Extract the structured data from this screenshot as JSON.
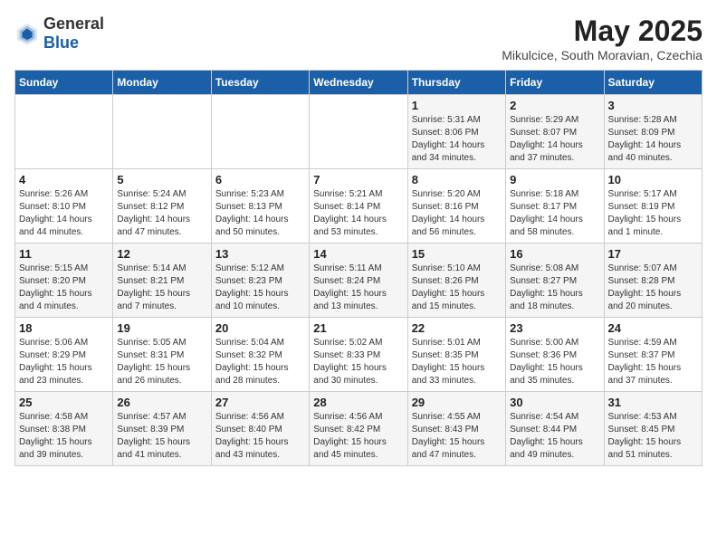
{
  "header": {
    "logo_general": "General",
    "logo_blue": "Blue",
    "month_title": "May 2025",
    "subtitle": "Mikulcice, South Moravian, Czechia"
  },
  "weekdays": [
    "Sunday",
    "Monday",
    "Tuesday",
    "Wednesday",
    "Thursday",
    "Friday",
    "Saturday"
  ],
  "weeks": [
    [
      {
        "day": "",
        "info": ""
      },
      {
        "day": "",
        "info": ""
      },
      {
        "day": "",
        "info": ""
      },
      {
        "day": "",
        "info": ""
      },
      {
        "day": "1",
        "info": "Sunrise: 5:31 AM\nSunset: 8:06 PM\nDaylight: 14 hours\nand 34 minutes."
      },
      {
        "day": "2",
        "info": "Sunrise: 5:29 AM\nSunset: 8:07 PM\nDaylight: 14 hours\nand 37 minutes."
      },
      {
        "day": "3",
        "info": "Sunrise: 5:28 AM\nSunset: 8:09 PM\nDaylight: 14 hours\nand 40 minutes."
      }
    ],
    [
      {
        "day": "4",
        "info": "Sunrise: 5:26 AM\nSunset: 8:10 PM\nDaylight: 14 hours\nand 44 minutes."
      },
      {
        "day": "5",
        "info": "Sunrise: 5:24 AM\nSunset: 8:12 PM\nDaylight: 14 hours\nand 47 minutes."
      },
      {
        "day": "6",
        "info": "Sunrise: 5:23 AM\nSunset: 8:13 PM\nDaylight: 14 hours\nand 50 minutes."
      },
      {
        "day": "7",
        "info": "Sunrise: 5:21 AM\nSunset: 8:14 PM\nDaylight: 14 hours\nand 53 minutes."
      },
      {
        "day": "8",
        "info": "Sunrise: 5:20 AM\nSunset: 8:16 PM\nDaylight: 14 hours\nand 56 minutes."
      },
      {
        "day": "9",
        "info": "Sunrise: 5:18 AM\nSunset: 8:17 PM\nDaylight: 14 hours\nand 58 minutes."
      },
      {
        "day": "10",
        "info": "Sunrise: 5:17 AM\nSunset: 8:19 PM\nDaylight: 15 hours\nand 1 minute."
      }
    ],
    [
      {
        "day": "11",
        "info": "Sunrise: 5:15 AM\nSunset: 8:20 PM\nDaylight: 15 hours\nand 4 minutes."
      },
      {
        "day": "12",
        "info": "Sunrise: 5:14 AM\nSunset: 8:21 PM\nDaylight: 15 hours\nand 7 minutes."
      },
      {
        "day": "13",
        "info": "Sunrise: 5:12 AM\nSunset: 8:23 PM\nDaylight: 15 hours\nand 10 minutes."
      },
      {
        "day": "14",
        "info": "Sunrise: 5:11 AM\nSunset: 8:24 PM\nDaylight: 15 hours\nand 13 minutes."
      },
      {
        "day": "15",
        "info": "Sunrise: 5:10 AM\nSunset: 8:26 PM\nDaylight: 15 hours\nand 15 minutes."
      },
      {
        "day": "16",
        "info": "Sunrise: 5:08 AM\nSunset: 8:27 PM\nDaylight: 15 hours\nand 18 minutes."
      },
      {
        "day": "17",
        "info": "Sunrise: 5:07 AM\nSunset: 8:28 PM\nDaylight: 15 hours\nand 20 minutes."
      }
    ],
    [
      {
        "day": "18",
        "info": "Sunrise: 5:06 AM\nSunset: 8:29 PM\nDaylight: 15 hours\nand 23 minutes."
      },
      {
        "day": "19",
        "info": "Sunrise: 5:05 AM\nSunset: 8:31 PM\nDaylight: 15 hours\nand 26 minutes."
      },
      {
        "day": "20",
        "info": "Sunrise: 5:04 AM\nSunset: 8:32 PM\nDaylight: 15 hours\nand 28 minutes."
      },
      {
        "day": "21",
        "info": "Sunrise: 5:02 AM\nSunset: 8:33 PM\nDaylight: 15 hours\nand 30 minutes."
      },
      {
        "day": "22",
        "info": "Sunrise: 5:01 AM\nSunset: 8:35 PM\nDaylight: 15 hours\nand 33 minutes."
      },
      {
        "day": "23",
        "info": "Sunrise: 5:00 AM\nSunset: 8:36 PM\nDaylight: 15 hours\nand 35 minutes."
      },
      {
        "day": "24",
        "info": "Sunrise: 4:59 AM\nSunset: 8:37 PM\nDaylight: 15 hours\nand 37 minutes."
      }
    ],
    [
      {
        "day": "25",
        "info": "Sunrise: 4:58 AM\nSunset: 8:38 PM\nDaylight: 15 hours\nand 39 minutes."
      },
      {
        "day": "26",
        "info": "Sunrise: 4:57 AM\nSunset: 8:39 PM\nDaylight: 15 hours\nand 41 minutes."
      },
      {
        "day": "27",
        "info": "Sunrise: 4:56 AM\nSunset: 8:40 PM\nDaylight: 15 hours\nand 43 minutes."
      },
      {
        "day": "28",
        "info": "Sunrise: 4:56 AM\nSunset: 8:42 PM\nDaylight: 15 hours\nand 45 minutes."
      },
      {
        "day": "29",
        "info": "Sunrise: 4:55 AM\nSunset: 8:43 PM\nDaylight: 15 hours\nand 47 minutes."
      },
      {
        "day": "30",
        "info": "Sunrise: 4:54 AM\nSunset: 8:44 PM\nDaylight: 15 hours\nand 49 minutes."
      },
      {
        "day": "31",
        "info": "Sunrise: 4:53 AM\nSunset: 8:45 PM\nDaylight: 15 hours\nand 51 minutes."
      }
    ]
  ]
}
